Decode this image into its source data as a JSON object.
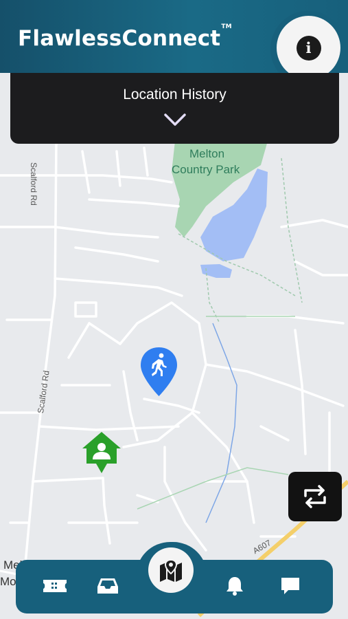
{
  "app": {
    "brand_name": "FlawlessConnect",
    "trademark": "TM"
  },
  "panel": {
    "title": "Location History"
  },
  "map": {
    "labels": {
      "park_line1": "Melton",
      "park_line2": "Country Park",
      "road_scalford_top": "Scalford Rd",
      "road_scalford_mid": "Scalford Rd",
      "road_a607": "A607",
      "edge_mel": "Mel",
      "edge_mo": "Mo"
    },
    "markers": {
      "walking": {
        "icon": "walking-person-icon",
        "color": "#2f7ef0"
      },
      "home": {
        "icon": "home-person-icon",
        "color": "#2aa02a"
      }
    }
  },
  "colors": {
    "header": "#17607c",
    "panel": "#1c1c1e",
    "park": "#a8d5b2",
    "water": "#a3bef5",
    "main_road": "#f4cf6a"
  },
  "nav": {
    "items": [
      {
        "icon": "ticket-icon"
      },
      {
        "icon": "inbox-icon"
      },
      {
        "icon": "map-pin-icon",
        "active": true
      },
      {
        "icon": "bell-icon"
      },
      {
        "icon": "chat-bubble-icon"
      }
    ]
  }
}
